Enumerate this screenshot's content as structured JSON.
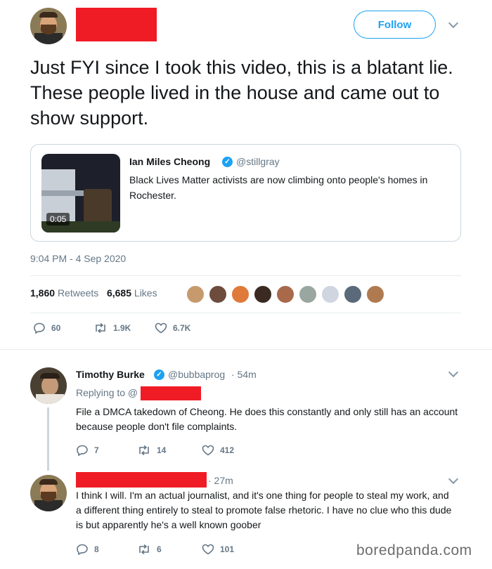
{
  "main_tweet": {
    "follow_label": "Follow",
    "text": "Just FYI since I took this video, this is a blatant lie. These people lived in the house and came out to show support.",
    "timestamp": "9:04 PM - 4 Sep 2020",
    "retweets_count": "1,860",
    "retweets_label": "Retweets",
    "likes_count": "6,685",
    "likes_label": "Likes",
    "reply_count": "60",
    "retweet_count": "1.9K",
    "like_count": "6.7K"
  },
  "quoted_tweet": {
    "name": "Ian Miles Cheong",
    "handle": "@stillgray",
    "text": "Black Lives Matter activists are now climbing onto people's homes in Rochester.",
    "video_duration": "0:05"
  },
  "replies": [
    {
      "name": "Timothy Burke",
      "handle": "@bubbaprog",
      "time": "· 54m",
      "replying_to": "Replying to @",
      "text": "File a DMCA takedown of Cheong. He does this constantly and only still has an account because people don't file complaints.",
      "reply_count": "7",
      "retweet_count": "14",
      "like_count": "412"
    },
    {
      "time": "· 27m",
      "text": "I think I will. I'm an actual journalist, and it's one thing for people to steal my work, and a different thing entirely to steal to promote false rhetoric. I have no clue who this dude is but apparently he's a well known goober",
      "reply_count": "8",
      "retweet_count": "6",
      "like_count": "101"
    }
  ],
  "watermark": "boredpanda.com",
  "colors": {
    "accent": "#1da1f2",
    "redaction": "#ef1c25",
    "muted": "#657786"
  },
  "icons": [
    "reply-icon",
    "retweet-icon",
    "like-icon",
    "verified-icon",
    "chevron-down-icon"
  ]
}
